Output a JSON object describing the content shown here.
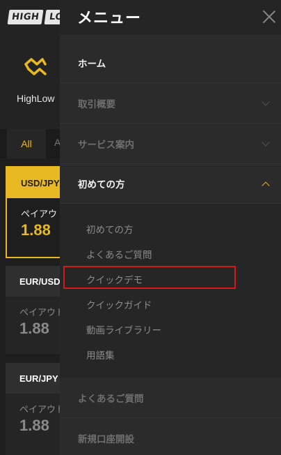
{
  "background": {
    "logo": {
      "part1": "HIGH",
      "part2": "LO"
    },
    "brand_name": "HighLow",
    "tabs": {
      "all": "All",
      "second": "A"
    },
    "cards": [
      {
        "pair": "USD/JPY",
        "label": "ペイアウト",
        "value": "1.88"
      },
      {
        "pair": "EUR/USD",
        "label": "ペイアウト",
        "value": "1.88"
      },
      {
        "pair": "EUR/JPY",
        "label": "ペイアウト",
        "value": "1.88"
      }
    ]
  },
  "menu": {
    "title": "メニュー",
    "items": {
      "home": "ホーム",
      "trade_overview": "取引概要",
      "services": "サービス案内",
      "beginners": "初めての方",
      "faq": "よくあるご質問",
      "open_account": "新規口座開設"
    },
    "beginners_sub": [
      "初めての方",
      "よくあるご質問",
      "クイックデモ",
      "クイックガイド",
      "動画ライブラリー",
      "用語集"
    ]
  },
  "colors": {
    "accent": "#e8b923",
    "highlight_box": "#d11a1a"
  }
}
